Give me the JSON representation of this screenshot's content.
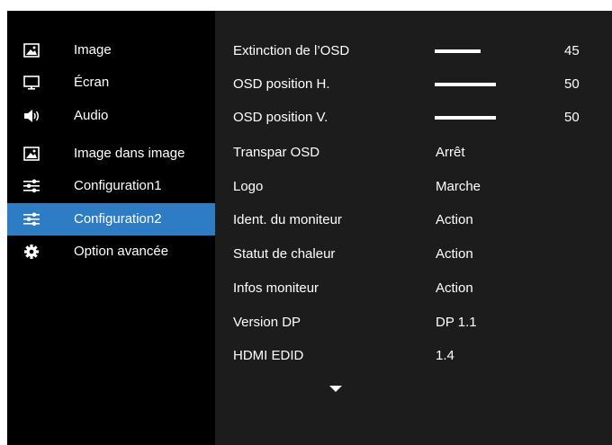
{
  "sidebar": {
    "items": [
      {
        "label": "Image",
        "icon": "image-icon",
        "selected": false
      },
      {
        "label": "Écran",
        "icon": "monitor-icon",
        "selected": false
      },
      {
        "label": "Audio",
        "icon": "speaker-icon",
        "selected": false
      },
      {
        "label": "Image dans image",
        "icon": "image-icon",
        "selected": false
      },
      {
        "label": "Configuration1",
        "icon": "sliders-icon",
        "selected": false
      },
      {
        "label": "Configuration2",
        "icon": "sliders-icon",
        "selected": true
      },
      {
        "label": "Option avancée",
        "icon": "gear-icon",
        "selected": false
      }
    ]
  },
  "settings": {
    "rows": [
      {
        "label": "Extinction de l’OSD",
        "type": "slider",
        "value": "45",
        "level": 45,
        "max": 60
      },
      {
        "label": "OSD position H.",
        "type": "slider",
        "value": "50",
        "level": 50,
        "max": 50
      },
      {
        "label": "OSD position V.",
        "type": "slider",
        "value": "50",
        "level": 50,
        "max": 50
      },
      {
        "label": "Transpar OSD",
        "type": "text",
        "value": "Arrêt"
      },
      {
        "label": "Logo",
        "type": "text",
        "value": "Marche"
      },
      {
        "label": "Ident. du moniteur",
        "type": "text",
        "value": "Action"
      },
      {
        "label": "Statut de chaleur",
        "type": "text",
        "value": "Action"
      },
      {
        "label": "Infos moniteur",
        "type": "text",
        "value": "Action"
      },
      {
        "label": "Version DP",
        "type": "text",
        "value": "DP 1.1"
      },
      {
        "label": "HDMI EDID",
        "type": "text",
        "value": "1.4"
      }
    ],
    "more_indicator": "chevron-down-icon"
  },
  "colors": {
    "selected": "#2e7cc4",
    "sidebar_bg": "#000000",
    "panel_bg": "#1c1c1c",
    "text": "#ffffff"
  }
}
